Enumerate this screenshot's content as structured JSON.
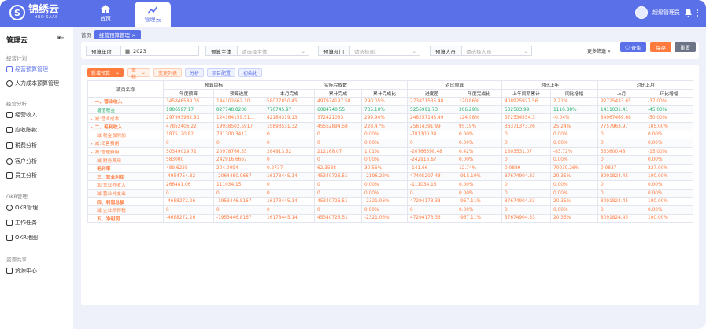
{
  "app": {
    "name": "锦绣云",
    "sub": "— HRO SAAS —"
  },
  "nav": [
    {
      "label": "首页",
      "icon": "home-icon"
    },
    {
      "label": "管理云",
      "icon": "chart-icon",
      "active": true
    }
  ],
  "user": {
    "name": "超级管理员"
  },
  "sidebar": {
    "title": "管理云",
    "sections": [
      {
        "label": "经营计划",
        "items": [
          "经营预算管理",
          "人力成本预算管理"
        ]
      },
      {
        "label": "经营分析",
        "items": [
          "经营收入",
          "应收账款",
          "税费分析",
          "客户分析",
          "员工分析"
        ]
      },
      {
        "label": "OKR管理",
        "items": [
          "OKR管理",
          "工作任务",
          "OKR地图"
        ]
      },
      {
        "label": "资源共享",
        "items": [
          "资源中心"
        ]
      }
    ]
  },
  "breadcrumb": {
    "home": "首页",
    "tab": "经营预算管理"
  },
  "filters": {
    "year_label": "预算年度",
    "year_value": "2023",
    "subject_label": "预算主体",
    "subject_placeholder": "请选择主体",
    "dept_label": "预算部门",
    "dept_placeholder": "请选择部门",
    "person_label": "预算人员",
    "person_placeholder": "请选择人员",
    "more": "更多筛选",
    "query": "查询",
    "save": "保存",
    "reset": "重置"
  },
  "toolbar": [
    "新增预算",
    "审核",
    "变更列表",
    "分析",
    "项目配置",
    "初始化"
  ],
  "headers": {
    "group": [
      "项目名称",
      "预算目标",
      "实际完成数",
      "对比预算",
      "对比上年",
      "对比上月"
    ],
    "sub": [
      "年度预算",
      "预算进度",
      "本月完成",
      "累计完成",
      "累计完成比",
      "进度差",
      "年度完成比",
      "上年同期累计",
      "同比增幅",
      "上月",
      "环比增幅"
    ]
  },
  "rows": [
    {
      "name": "一、营业收入",
      "arrow": true,
      "bold": true,
      "v": [
        "345846589.05",
        "144102662.10...",
        "58077850.45",
        "497974197.58",
        "290.05%",
        "273871535.48",
        "120.86%",
        "408925927.56",
        "2.21%",
        "92725433.65",
        "-37.00%"
      ]
    },
    {
      "name": "增值税金",
      "green": true,
      "v": [
        "1986597.17",
        "827748.8208",
        "770745.97",
        "6084740.55",
        "735.10%",
        "5256991.73",
        "306.29%",
        "502503.99",
        "1110.88%",
        "1411031.41",
        "-45.00%"
      ]
    },
    {
      "name": "减:营业成本",
      "arrow": true,
      "v": [
        "297993982.83",
        "124164159.51...",
        "42184319.13",
        "372421033",
        "299.94%",
        "248257143.49",
        "124.98%",
        "372534554.3",
        "-0.04%",
        "84967469.68",
        "-50.00%"
      ]
    },
    {
      "name": "二、毛利收入",
      "arrow": true,
      "bold": true,
      "v": [
        "47852406.22",
        "19938502.5917",
        "15893531.32",
        "45552894.58",
        "228.47%",
        "25614391.99",
        "95.19%",
        "36371373.26",
        "25.24%",
        "7757963.97",
        "105.00%"
      ]
    },
    {
      "name": "减:税金及附加",
      "v": [
        "1875120.82",
        "781300.3417",
        "0",
        "0",
        "0.00%",
        "-781300.34",
        "0.00%",
        "0",
        "0.00%",
        "0",
        "0.00%"
      ]
    },
    {
      "name": "减:销售费用",
      "arrow": true,
      "v": [
        "0",
        "0",
        "0",
        "0",
        "0.00%",
        "0",
        "0.00%",
        "0",
        "0.00%",
        "0",
        "0.00%"
      ]
    },
    {
      "name": "减:管理费用",
      "arrow": true,
      "v": [
        "50349019.72",
        "20978766.55",
        "284913.82",
        "212168.07",
        "1.01%",
        "-20766598.48",
        "0.42%",
        "1303531.07",
        "-83.72%",
        "333600.48",
        "-15.00%"
      ]
    },
    {
      "name": "减:财务费用",
      "v": [
        "583000",
        "242916.6667",
        "0",
        "0",
        "0.00%",
        "-242916.67",
        "0.00%",
        "0",
        "0.00%",
        "0",
        "0.00%"
      ]
    },
    {
      "name": "毛利率",
      "bold": true,
      "v": [
        "489.6225",
        "204.0094",
        "0.2737",
        "62.3538",
        "30.56%",
        "-141.66",
        "12.74%",
        "0.0889",
        "70039.26%",
        "0.0837",
        "227.00%"
      ]
    },
    {
      "name": "三、营业利润",
      "bold": true,
      "v": [
        "-4954754.32",
        "-2064480.9667",
        "16178445.14",
        "45340726.51",
        "-2196.22%",
        "47405207.48",
        "-915.10%",
        "37674904.33",
        "20.35%",
        "8091824.45",
        "100.00%"
      ]
    },
    {
      "name": "加:营业外收入",
      "v": [
        "266481.06",
        "111034.15",
        "0",
        "0",
        "0.00%",
        "-111034.15",
        "0.00%",
        "0",
        "0.00%",
        "0",
        "0.00%"
      ]
    },
    {
      "name": "减:营业外支出",
      "v": [
        "0",
        "0",
        "0",
        "0",
        "0.00%",
        "0",
        "0.00%",
        "0",
        "0.00%",
        "0",
        "0.00%"
      ]
    },
    {
      "name": "四、利润总额",
      "bold": true,
      "v": [
        "-4688272.26",
        "-1953446.8167",
        "16178445.14",
        "45340726.51",
        "-2321.06%",
        "47294173.33",
        "-967.11%",
        "37674904.33",
        "20.35%",
        "8091824.45",
        "100.00%"
      ]
    },
    {
      "name": "减:企业所得税",
      "v": [
        "0",
        "0",
        "0",
        "0",
        "0.00%",
        "0",
        "0.00%",
        "0",
        "0.00%",
        "0",
        "0.00%"
      ]
    },
    {
      "name": "五、净利润",
      "bold": true,
      "v": [
        "-4688272.26",
        "-1953446.8167",
        "16178445.14",
        "45340726.51",
        "-2321.06%",
        "47294173.33",
        "-967.11%",
        "37674904.33",
        "20.35%",
        "8091824.45",
        "100.00%"
      ]
    }
  ]
}
